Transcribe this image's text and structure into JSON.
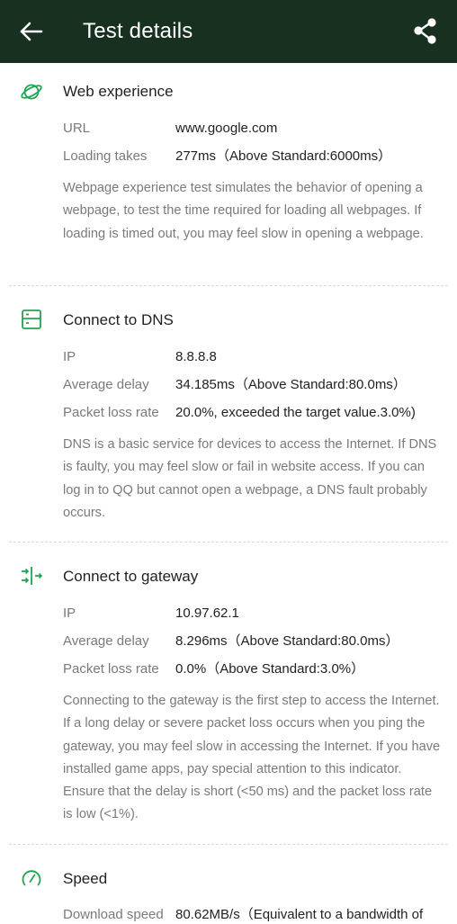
{
  "header": {
    "title": "Test details",
    "back_icon": "arrow-left-icon",
    "share_icon": "share-icon",
    "background": "#17301f"
  },
  "accent_color": "#23a455",
  "web": {
    "title": "Web experience",
    "icon": "planet-icon",
    "url_label": "URL",
    "url_value": "www.google.com",
    "loading_label": "Loading takes",
    "loading_value": "277ms（Above Standard:6000ms）",
    "description": "Webpage experience test simulates the behavior of opening a webpage, to test the time required for loading all webpages. If loading is timed out, you may feel slow in opening a webpage."
  },
  "dns": {
    "title": "Connect to DNS",
    "icon": "server-icon",
    "ip_label": "IP",
    "ip_value": "8.8.8.8",
    "delay_label": "Average delay",
    "delay_value": "34.185ms（Above Standard:80.0ms）",
    "loss_label": "Packet loss rate",
    "loss_value": "20.0%, exceeded the target value.3.0%)",
    "description": "DNS is a basic service for devices to access the Internet. If DNS is faulty, you may feel slow or fail in website access. If you can log in to QQ but cannot open a webpage, a DNS fault probably occurs."
  },
  "gateway": {
    "title": "Connect to gateway",
    "icon": "gateway-icon",
    "ip_label": "IP",
    "ip_value": "10.97.62.1",
    "delay_label": "Average delay",
    "delay_value": "8.296ms（Above Standard:80.0ms）",
    "loss_label": "Packet loss rate",
    "loss_value": "0.0%（Above Standard:3.0%）",
    "description": "Connecting to the gateway is the first step to access the Internet. If a long delay or severe packet loss occurs when you ping the gateway, you may feel slow in accessing the Internet. If you have installed game apps, pay special attention to this indicator. Ensure that the delay is short (<50 ms) and the packet loss rate is low (<1%)."
  },
  "speed": {
    "title": "Speed",
    "icon": "speedometer-icon",
    "download_label": "Download speed",
    "download_value": "80.62MB/s（Equivalent to a bandwidth of"
  }
}
